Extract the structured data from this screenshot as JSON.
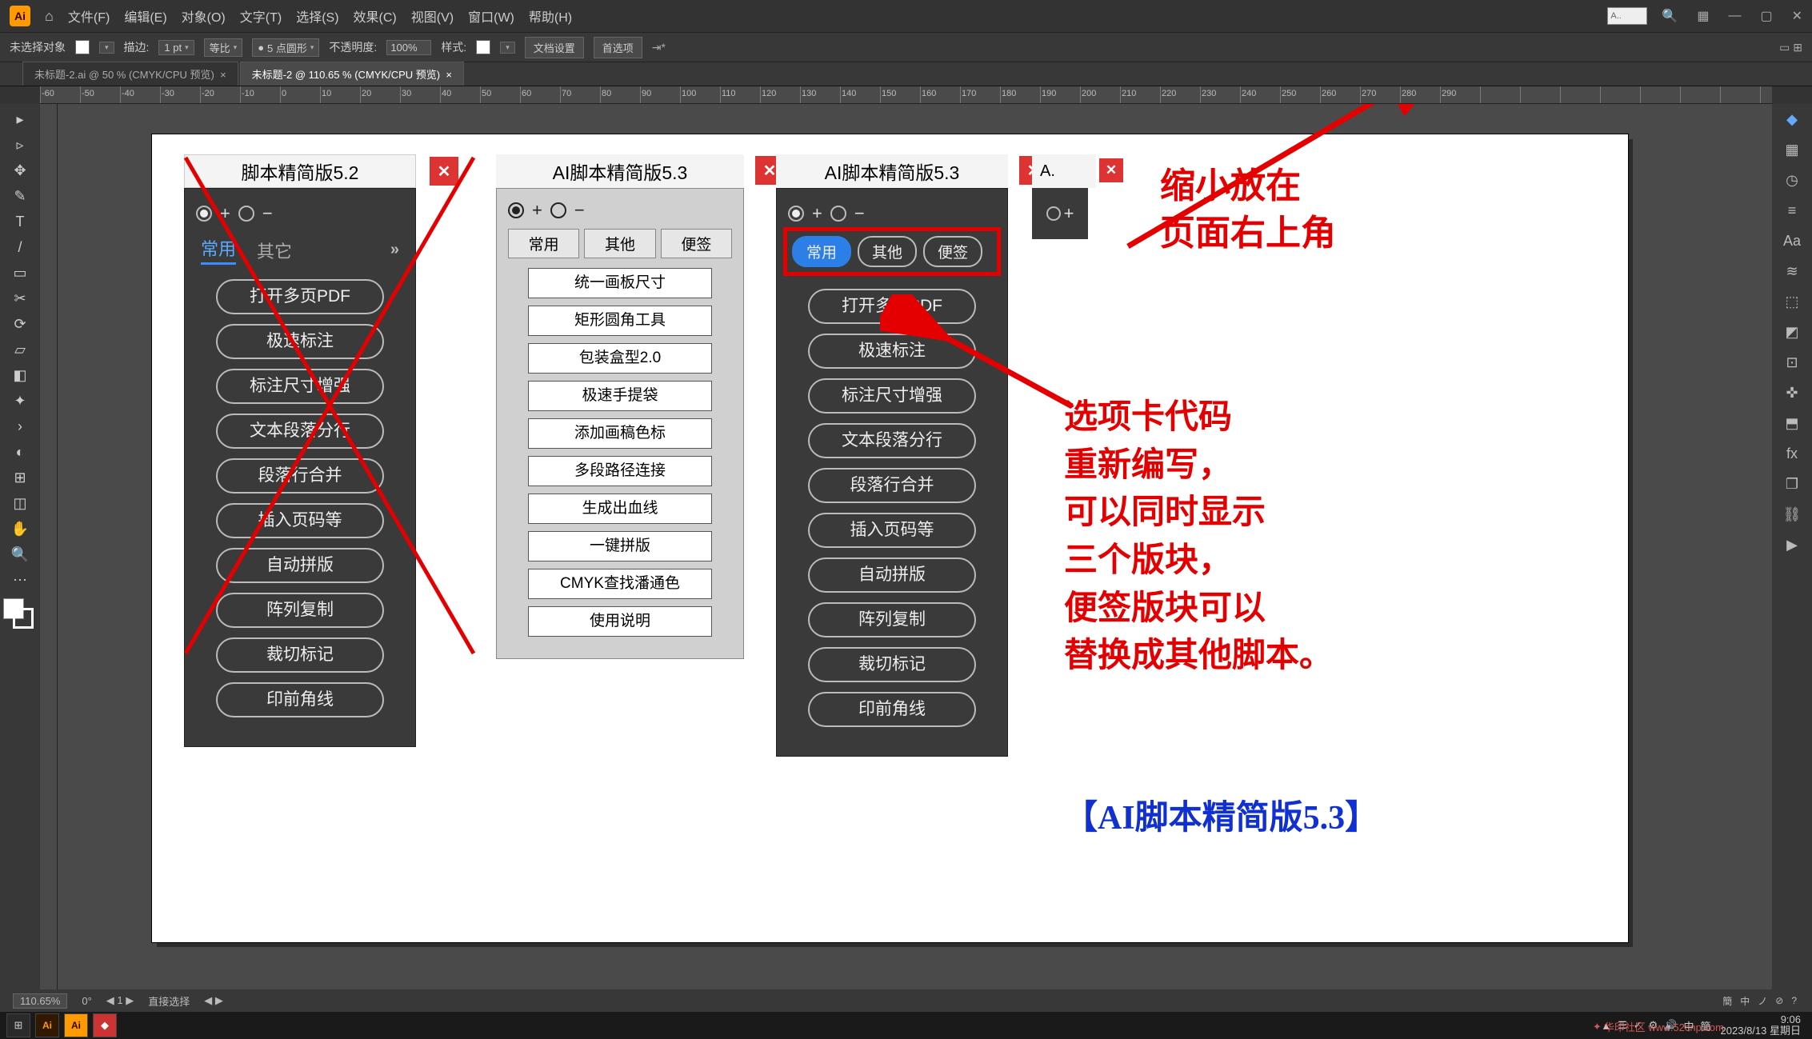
{
  "menubar": {
    "items": [
      "文件(F)",
      "编辑(E)",
      "对象(O)",
      "文字(T)",
      "选择(S)",
      "效果(C)",
      "视图(V)",
      "窗口(W)",
      "帮助(H)"
    ],
    "search_placeholder": "A..",
    "win_min": "—",
    "win_max": "▢",
    "win_close": "✕"
  },
  "optbar": {
    "no_sel": "未选择对象",
    "stroke_label": "描边:",
    "stroke_val": "1 pt",
    "uniform": "等比",
    "pt5": "5 点圆形",
    "opacity_label": "不透明度:",
    "opacity_val": "100%",
    "style_label": "样式:",
    "doc_setup": "文档设置",
    "prefs": "首选项"
  },
  "doctabs": {
    "tab1": "未标题-2.ai @ 50 % (CMYK/CPU 预览)",
    "tab2": "未标题-2 @ 110.65 % (CMYK/CPU 预览)"
  },
  "ruler_numbers": [
    "-60",
    "-50",
    "-40",
    "-30",
    "-20",
    "-10",
    "0",
    "10",
    "20",
    "30",
    "40",
    "50",
    "60",
    "70",
    "80",
    "90",
    "100",
    "110",
    "120",
    "130",
    "140",
    "150",
    "160",
    "170",
    "180",
    "190",
    "200",
    "210",
    "220",
    "230",
    "240",
    "250",
    "260",
    "270",
    "280",
    "290"
  ],
  "statusbar": {
    "zoom": "110.65%",
    "rot": "0°",
    "artboard_nav": "1",
    "tool": "直接选择",
    "lang_indicators": [
      "簡",
      "中",
      "ノ",
      "⊘",
      "?"
    ]
  },
  "taskbar": {
    "time": "9:06",
    "date": "2023/8/13 星期日",
    "watermark": "华印社区 www.52cnp.com",
    "tray": [
      "▲",
      "☰",
      "✓",
      "⚙",
      "🔊",
      "中",
      "簡"
    ]
  },
  "panel1": {
    "title": "脚本精简版5.2",
    "tabs": [
      "常用",
      "其它"
    ],
    "buttons": [
      "打开多页PDF",
      "极速标注",
      "标注尺寸增强",
      "文本段落分行",
      "段落行合并",
      "插入页码等",
      "自动拼版",
      "阵列复制",
      "裁切标记",
      "印前角线"
    ]
  },
  "panel2": {
    "title": "AI脚本精简版5.3",
    "tabs": [
      "常用",
      "其他",
      "便签"
    ],
    "buttons": [
      "统一画板尺寸",
      "矩形圆角工具",
      "包装盒型2.0",
      "极速手提袋",
      "添加画稿色标",
      "多段路径连接",
      "生成出血线",
      "一键拼版",
      "CMYK查找潘通色",
      "使用说明"
    ]
  },
  "panel3": {
    "title": "AI脚本精简版5.3",
    "tabs": [
      "常用",
      "其他",
      "便签"
    ],
    "buttons": [
      "打开多页PDF",
      "极速标注",
      "标注尺寸增强",
      "文本段落分行",
      "段落行合并",
      "插入页码等",
      "自动拼版",
      "阵列复制",
      "裁切标记",
      "印前角线"
    ]
  },
  "panel4": {
    "title": "A."
  },
  "anno1_l1": "缩小放在",
  "anno1_l2": "页面右上角",
  "anno2_text": "选项卡代码\n重新编写，\n可以同时显示\n三个版块，\n便签版块可以\n替换成其他脚本。",
  "anno3_text": "【AI脚本精简版5.3】",
  "tools_left": [
    "▸",
    "▹",
    "✥",
    "✎",
    "T",
    "/",
    "▭",
    "✂",
    "⟳",
    "▱",
    "◧",
    "✦",
    "›",
    "◐",
    "⊞",
    "◫",
    "✋",
    "🔍",
    "⋯"
  ],
  "panels_right": [
    "◆",
    "▦",
    "◷",
    "≡",
    "Aa",
    "≋",
    "⬚",
    "◩",
    "⊡",
    "✜",
    "⬒",
    "fx",
    "❐",
    "⛓",
    "▶"
  ]
}
